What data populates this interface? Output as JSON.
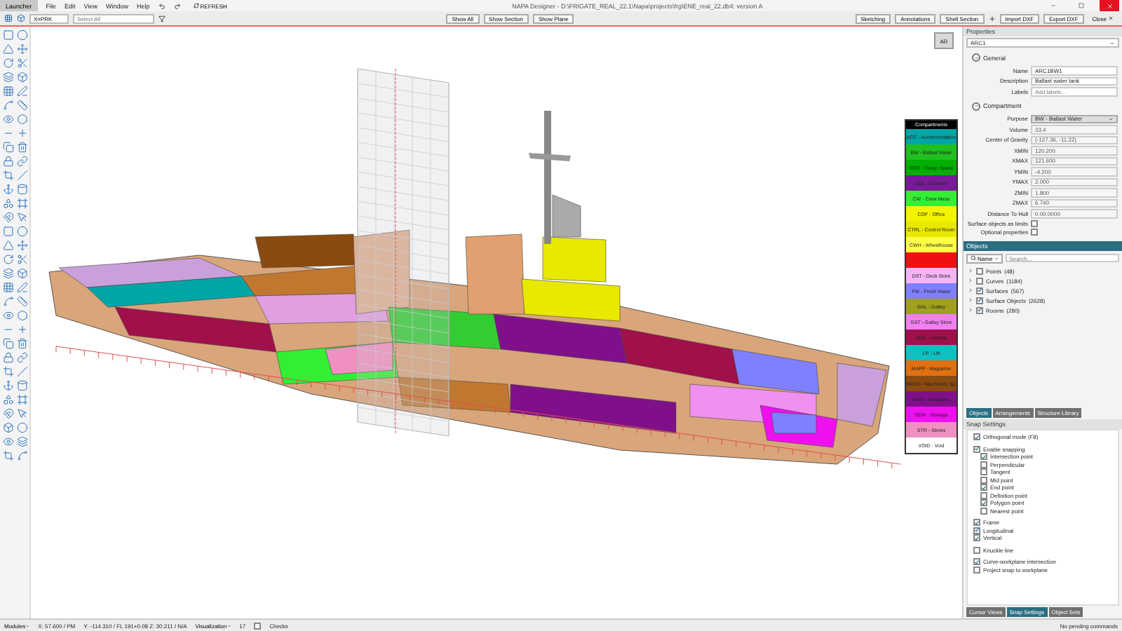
{
  "title_bar": {
    "launcher": "Launcher",
    "menu": [
      "File",
      "Edit",
      "View",
      "Window",
      "Help"
    ],
    "refresh": "REFRESH",
    "title": "NAPA Designer - D:\\FRIGATE_REAL_22.1\\Napa\\projects\\frg\\ENE_real_22.db4: version A"
  },
  "toolbar": {
    "coordinate": "X=PRK",
    "select_placeholder": "Select All",
    "left_buttons": [
      "Show All",
      "Show Section",
      "Show Plane"
    ],
    "right_buttons": [
      "Sketching",
      "Annotations",
      "Shell Section"
    ],
    "file_buttons": [
      "Import DXF",
      "Export DXF"
    ],
    "close": "Close"
  },
  "viewcube": {
    "label": "AR"
  },
  "legend": {
    "title": "Compartments",
    "items": [
      {
        "label": "ACC - Accommodation",
        "color": "#00a6a6"
      },
      {
        "label": "BW - Ballast Water",
        "color": "#1fc01f"
      },
      {
        "label": "CGO - Cargo Space",
        "color": "#00b000"
      },
      {
        "label": "COL - Collision",
        "color": "#7a1a9a"
      },
      {
        "label": "CW - Crew Mess",
        "color": "#33ee33"
      },
      {
        "label": "COF - Office",
        "color": "#f4f400"
      },
      {
        "label": "CTRL - Control Room",
        "color": "#e8e800"
      },
      {
        "label": "CWH - Wheelhouse",
        "color": "#ffff44"
      },
      {
        "color": "#ee1111"
      },
      {
        "label": "DST - Deck Store",
        "color": "#f5b5f5"
      },
      {
        "label": "FW - Fresh Water",
        "color": "#8080ff"
      },
      {
        "label": "GAL - Galley",
        "color": "#a0a020"
      },
      {
        "label": "GST - Galley Store",
        "color": "#f080f0"
      },
      {
        "label": "HNG - Hangar",
        "color": "#a0104a"
      },
      {
        "label": "LR - Lift",
        "color": "#10c0c0"
      },
      {
        "label": "MAPP - Magazine",
        "color": "#e07010"
      },
      {
        "label": "MACH - Machinery Sp.",
        "color": "#8a4a10"
      },
      {
        "label": "MAG - Magazine",
        "color": "#80108a"
      },
      {
        "label": "SEW - Sewage",
        "color": "#ee10ee"
      },
      {
        "label": "STR - Stores",
        "color": "#f090c0"
      },
      {
        "label": "VOID - Void",
        "color": "#ffffff"
      }
    ]
  },
  "properties": {
    "title": "Properties",
    "object": "ARC1",
    "general": {
      "title": "General",
      "fields": [
        {
          "label": "Name",
          "value": "ARC1BW1"
        },
        {
          "label": "Description",
          "value": "Ballast water tank"
        },
        {
          "label": "Labels",
          "placeholder": "Add labels..."
        }
      ]
    },
    "compartment": {
      "title": "Compartment",
      "purpose_label": "Purpose",
      "purpose": "BW - Ballast Water",
      "fields": [
        {
          "label": "Volume",
          "value": "33.4"
        },
        {
          "label": "Center of Gravity",
          "value": "(-127.36, -11.22)"
        },
        {
          "label": "XMIN",
          "value": "120.200"
        },
        {
          "label": "XMAX",
          "value": "121.600"
        },
        {
          "label": "YMIN",
          "value": "-4.200"
        },
        {
          "label": "YMAX",
          "value": "2.000"
        },
        {
          "label": "ZMIN",
          "value": "1.800"
        },
        {
          "label": "ZMAX",
          "value": "6.740"
        },
        {
          "label": "Distance To Hull",
          "value": "0.00.0000"
        }
      ],
      "checks": [
        {
          "label": "Surface objects as limits",
          "checked": false
        },
        {
          "label": "Optional properties",
          "checked": false
        }
      ]
    }
  },
  "objects": {
    "title": "Objects",
    "filter": "Name",
    "search_placeholder": "Search...",
    "tree": [
      {
        "label": "Points",
        "count": "(48)",
        "checked": false
      },
      {
        "label": "Curves",
        "count": "(1184)",
        "checked": false
      },
      {
        "label": "Surfaces",
        "count": "(567)",
        "checked": true
      },
      {
        "label": "Surface Objects",
        "count": "(2628)",
        "checked": true
      },
      {
        "label": "Rooms",
        "count": "(280)",
        "checked": true
      }
    ],
    "tabs": [
      {
        "label": "Objects",
        "selected": true
      },
      {
        "label": "Arrangements",
        "selected": false
      },
      {
        "label": "Structure Library",
        "selected": false
      }
    ]
  },
  "snap_settings": {
    "title": "Snap Settings",
    "groups": [
      [
        {
          "label": "Orthogonal mode (F8)",
          "checked": true
        }
      ],
      [
        {
          "label": "Enable snapping",
          "checked": true,
          "children": [
            {
              "label": "Intersection point",
              "checked": true
            },
            {
              "label": "Perpendicular",
              "checked": false
            },
            {
              "label": "Tangent",
              "checked": false
            },
            {
              "label": "Mid point",
              "checked": false
            },
            {
              "label": "End point",
              "checked": true
            },
            {
              "label": "Definition point",
              "checked": false
            },
            {
              "label": "Polygon point",
              "checked": true
            },
            {
              "label": "Nearest point",
              "checked": false
            }
          ]
        }
      ],
      [
        {
          "label": "Frame",
          "checked": true
        },
        {
          "label": "Longitudinal",
          "checked": true
        },
        {
          "label": "Vertical",
          "checked": true
        }
      ],
      [
        {
          "label": "Knuckle line",
          "checked": false
        }
      ],
      [
        {
          "label": "Curve-workplane intersection",
          "checked": true
        },
        {
          "label": "Project snap to workplane",
          "checked": false
        }
      ]
    ],
    "tabs": [
      {
        "label": "Cursor Views",
        "selected": false
      },
      {
        "label": "Snap Settings",
        "selected": true
      },
      {
        "label": "Object Sets",
        "selected": false
      }
    ]
  },
  "status_bar": {
    "modules": "Modules",
    "x": "X: 57.600 / PM",
    "yz": "Y: -114.310 / FL 191+0.08  Z: 30.211 / N/A",
    "visualization": "Visualization",
    "count": "17",
    "checks": {
      "label": "Checks",
      "checked": false
    },
    "commands": "No pending commands"
  }
}
